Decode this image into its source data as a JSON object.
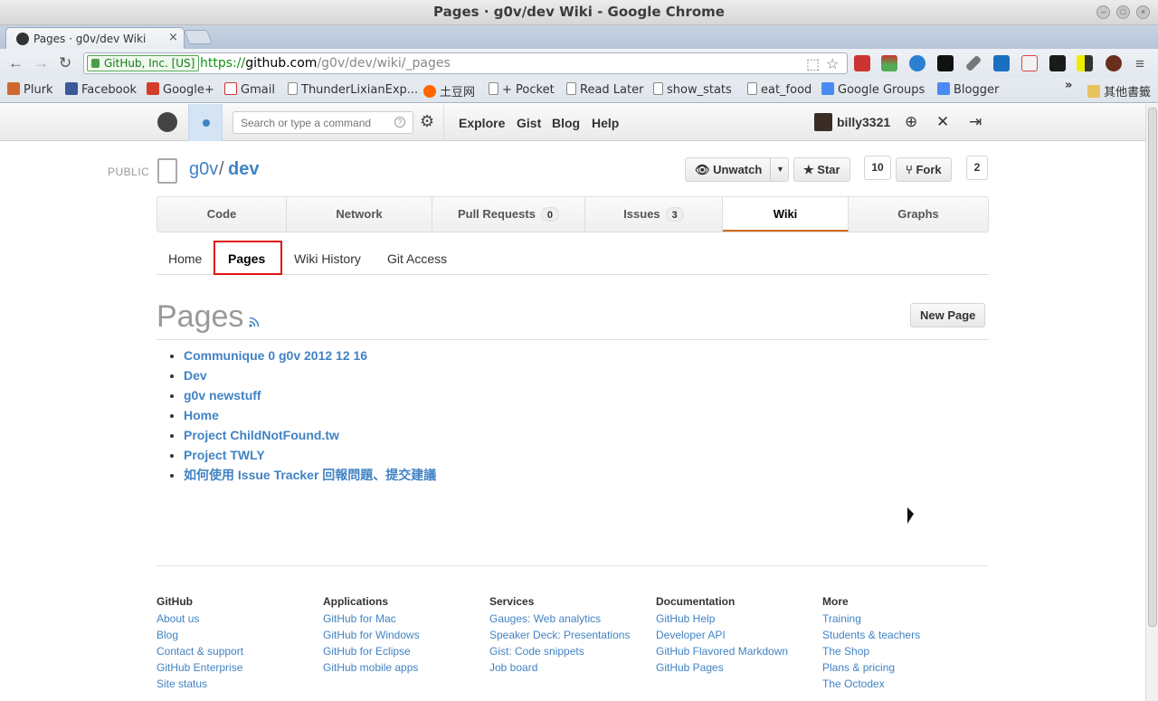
{
  "window": {
    "title": "Pages ·  g0v/dev Wiki - Google Chrome"
  },
  "tab": {
    "title": "Pages ·  g0v/dev Wiki",
    "close": "×"
  },
  "toolbar": {
    "ev_label": "GitHub, Inc. [US]",
    "url_scheme": "https://",
    "url_host": "github.com",
    "url_path": "/g0v/dev/wiki/_pages"
  },
  "bookmarks": {
    "items": [
      "Plurk",
      "Facebook",
      "Google+",
      "Gmail",
      "ThunderLixianExp...",
      "土豆网",
      "+ Pocket",
      "Read Later",
      "show_stats",
      "eat_food",
      "Google Groups",
      "Blogger"
    ],
    "more": "»",
    "other": "其他書籤"
  },
  "gh_header": {
    "search_placeholder": "Search or type a command",
    "nav": [
      "Explore",
      "Gist",
      "Blog",
      "Help"
    ],
    "username": "billy3321"
  },
  "repo": {
    "visibility": "PUBLIC",
    "owner": "g0v",
    "slash": "/",
    "name": "dev",
    "unwatch_label": "Unwatch",
    "star_label": "Star",
    "star_count": "10",
    "fork_label": "Fork",
    "fork_count": "2"
  },
  "repo_tabs": [
    {
      "label": "Code"
    },
    {
      "label": "Network"
    },
    {
      "label": "Pull Requests",
      "count": "0"
    },
    {
      "label": "Issues",
      "count": "3"
    },
    {
      "label": "Wiki"
    },
    {
      "label": "Graphs"
    }
  ],
  "wiki_nav": [
    "Home",
    "Pages",
    "Wiki History",
    "Git Access"
  ],
  "pages": {
    "title": "Pages",
    "new_page_label": "New Page",
    "items": [
      "Communique 0 g0v 2012 12 16",
      "Dev",
      "g0v newstuff",
      "Home",
      "Project ChildNotFound.tw",
      "Project TWLY",
      "如何使用 Issue Tracker 回報問題、提交建議"
    ]
  },
  "footer": [
    {
      "heading": "GitHub",
      "links": [
        "About us",
        "Blog",
        "Contact & support",
        "GitHub Enterprise",
        "Site status"
      ]
    },
    {
      "heading": "Applications",
      "links": [
        "GitHub for Mac",
        "GitHub for Windows",
        "GitHub for Eclipse",
        "GitHub mobile apps"
      ]
    },
    {
      "heading": "Services",
      "links": [
        "Gauges: Web analytics",
        "Speaker Deck: Presentations",
        "Gist: Code snippets",
        "Job board"
      ]
    },
    {
      "heading": "Documentation",
      "links": [
        "GitHub Help",
        "Developer API",
        "GitHub Flavored Markdown",
        "GitHub Pages"
      ]
    },
    {
      "heading": "More",
      "links": [
        "Training",
        "Students & teachers",
        "The Shop",
        "Plans & pricing",
        "The Octodex"
      ]
    }
  ],
  "colors": {
    "link": "#4183c4",
    "wiki_tab_accent": "#d26911",
    "highlight_box": "#e01010"
  }
}
